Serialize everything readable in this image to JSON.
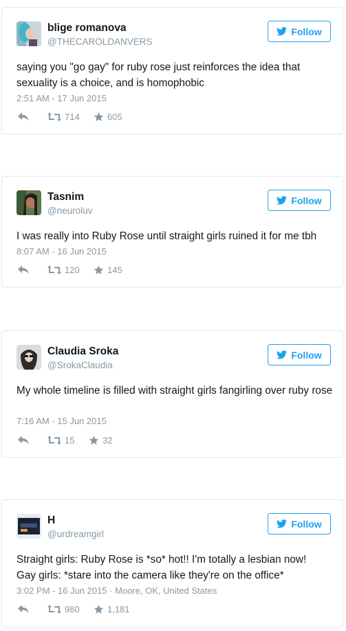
{
  "follow_label": "Follow",
  "colors": {
    "accent": "#1da1f2",
    "muted": "#8899a6",
    "border": "#e1e8ed"
  },
  "icons": {
    "reply": "reply-icon",
    "retweet": "retweet-icon",
    "favorite": "star-icon",
    "brand": "twitter-bird-icon"
  },
  "tweets": [
    {
      "name": "blige romanova",
      "handle": "@THECAROLDANVERS",
      "text": "saying you \"go gay\" for ruby rose just reinforces the idea that sexuality is a choice, and is homophobic",
      "time": "2:51 AM - 17 Jun 2015",
      "retweets": "714",
      "favorites": "605"
    },
    {
      "name": "Tasnim",
      "handle": "@neuroluv",
      "text": "I was really into Ruby Rose until straight girls ruined it for me tbh",
      "time": "8:07 AM - 16 Jun 2015",
      "retweets": "120",
      "favorites": "145"
    },
    {
      "name": "Claudia Sroka",
      "handle": "@SrokaClaudia",
      "text": "My whole timeline is filled with straight girls fangirling over ruby rose",
      "time": "7:16 AM - 15 Jun 2015",
      "retweets": "15",
      "favorites": "32"
    },
    {
      "name": "H",
      "handle": "@urdreamgirl",
      "text": "Straight girls: Ruby Rose is *so* hot!! I'm totally a lesbian now!\nGay girls: *stare into the camera like they're on the office*",
      "time": "3:02 PM - 16 Jun 2015 · Moore, OK, United States",
      "retweets": "980",
      "favorites": "1,181"
    }
  ]
}
